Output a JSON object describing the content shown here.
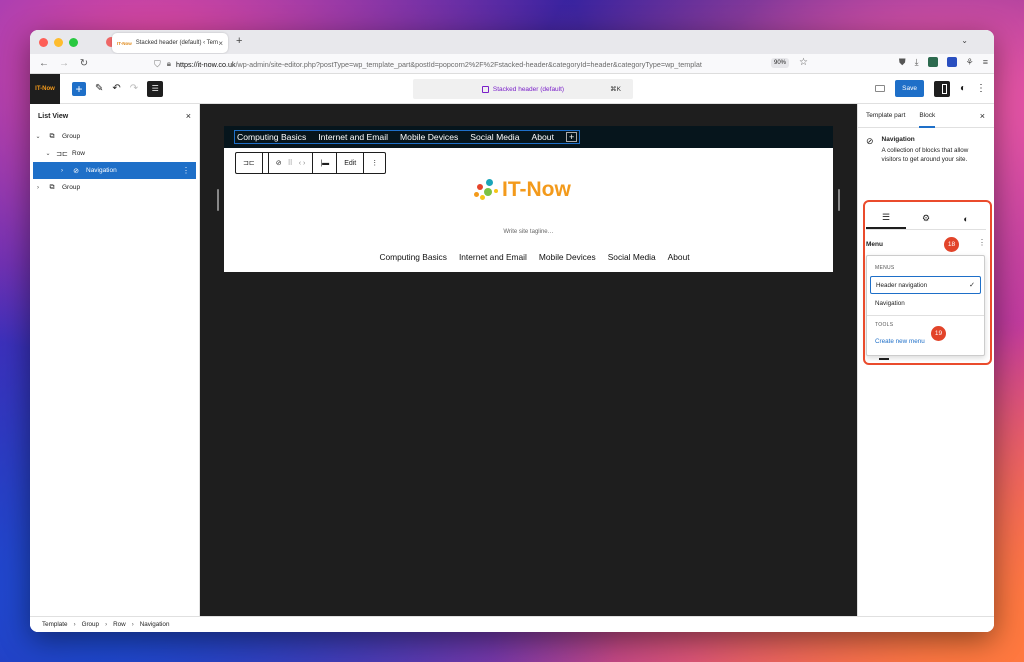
{
  "browser": {
    "tab_title": "Stacked header (default) ‹ Tem",
    "tab_favicon": "IT-Now",
    "url_domain": "https://it-now.co.uk",
    "url_path": "/wp-admin/site-editor.php?postType=wp_template_part&postId=popcorn2%2F%2Fstacked-header&categoryId=header&categoryType=wp_templat",
    "zoom": "90%"
  },
  "editor": {
    "logo_text": "IT-Now",
    "doc_title": "Stacked header (default)",
    "shortcut": "⌘K",
    "save_label": "Save"
  },
  "listview": {
    "title": "List View",
    "items": [
      {
        "label": "Group"
      },
      {
        "label": "Row"
      },
      {
        "label": "Navigation"
      },
      {
        "label": "Group"
      }
    ]
  },
  "canvas": {
    "top_nav": [
      "Computing Basics",
      "Internet and Email",
      "Mobile Devices",
      "Social Media",
      "About"
    ],
    "toolbar_edit": "Edit",
    "site_title": "IT-Now",
    "tagline": "Write site tagline…",
    "bottom_nav": [
      "Computing Basics",
      "Internet and Email",
      "Mobile Devices",
      "Social Media",
      "About"
    ]
  },
  "sidebar": {
    "tab_template": "Template part",
    "tab_block": "Block",
    "block_name": "Navigation",
    "block_desc": "A collection of blocks that allow visitors to get around your site.",
    "menu_label": "Menu",
    "badge_menu": "18",
    "badge_create": "19",
    "dropdown": {
      "group_menus": "MENUS",
      "item_header_nav": "Header navigation",
      "item_navigation": "Navigation",
      "group_tools": "TOOLS",
      "create_new": "Create new menu"
    },
    "highlight_color": "#ea4b2c"
  },
  "breadcrumb": [
    "Template",
    "Group",
    "Row",
    "Navigation"
  ]
}
